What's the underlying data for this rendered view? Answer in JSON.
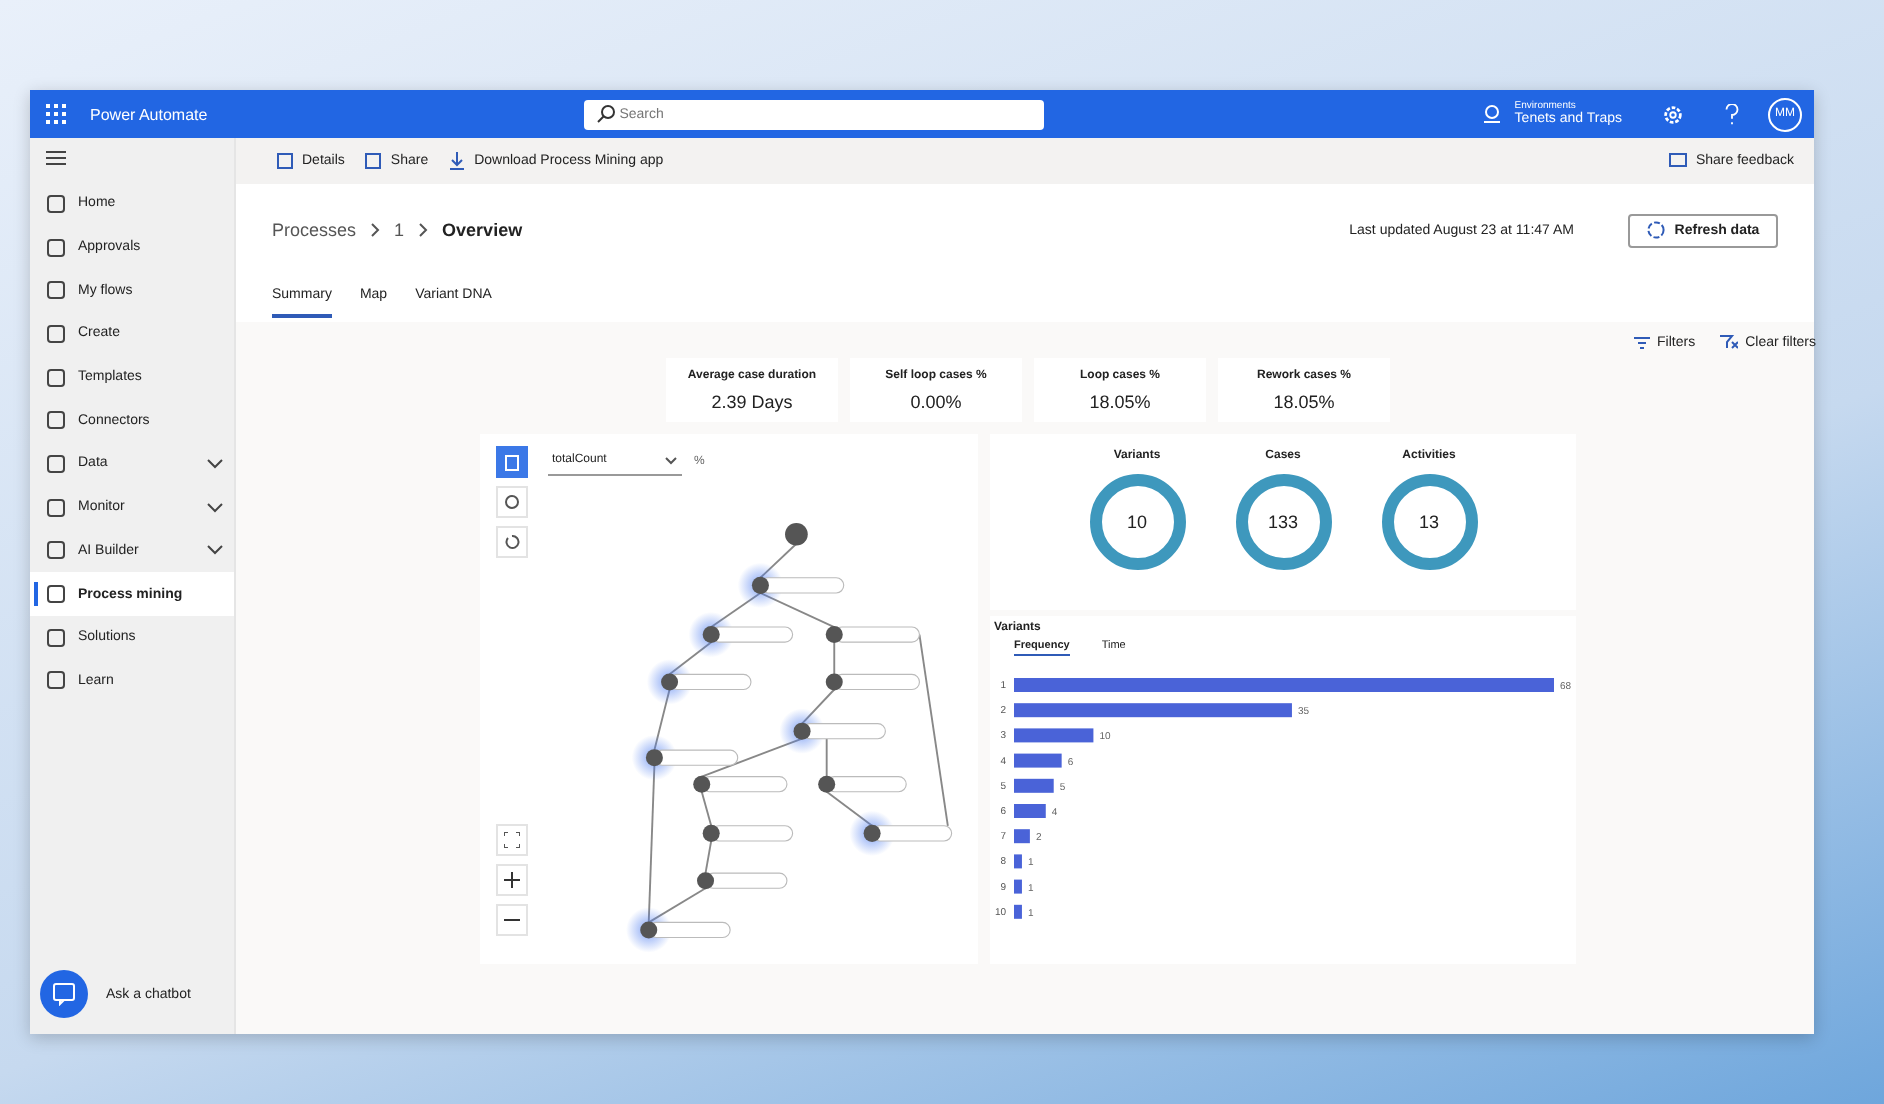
{
  "app_bar": {
    "title": "Power Automate",
    "search": {
      "placeholder": "Search"
    },
    "environment": {
      "label": "Environments",
      "name": "Tenets and Traps"
    },
    "avatar": "MM"
  },
  "sidebar": {
    "items": [
      {
        "label": "Home",
        "expandable": false,
        "selected": false
      },
      {
        "label": "Approvals",
        "expandable": false,
        "selected": false
      },
      {
        "label": "My flows",
        "expandable": false,
        "selected": false
      },
      {
        "label": "Create",
        "expandable": false,
        "selected": false
      },
      {
        "label": "Templates",
        "expandable": false,
        "selected": false
      },
      {
        "label": "Connectors",
        "expandable": false,
        "selected": false
      },
      {
        "label": "Data",
        "expandable": true,
        "selected": false
      },
      {
        "label": "Monitor",
        "expandable": true,
        "selected": false
      },
      {
        "label": "AI Builder",
        "expandable": true,
        "selected": false
      },
      {
        "label": "Process mining",
        "expandable": false,
        "selected": true
      },
      {
        "label": "Solutions",
        "expandable": false,
        "selected": false
      },
      {
        "label": "Learn",
        "expandable": false,
        "selected": false
      }
    ],
    "chatbot": "Ask a chatbot"
  },
  "command_bar": {
    "items": [
      "Details",
      "Share",
      "Download Process Mining app"
    ],
    "feedback": "Share feedback"
  },
  "breadcrumb": [
    "Processes",
    "1",
    "Overview"
  ],
  "last_updated": "Last updated August 23 at 11:47 AM",
  "refresh_button": "Refresh data",
  "tabs": [
    {
      "label": "Summary",
      "selected": true
    },
    {
      "label": "Map",
      "selected": false
    },
    {
      "label": "Variant DNA",
      "selected": false
    }
  ],
  "filters": {
    "filters": "Filters",
    "clear": "Clear filters"
  },
  "kpis": [
    {
      "label": "Average case duration",
      "value": "2.39 Days"
    },
    {
      "label": "Self loop cases %",
      "value": "0.00%"
    },
    {
      "label": "Loop cases %",
      "value": "18.05%"
    },
    {
      "label": "Rework cases %",
      "value": "18.05%"
    }
  ],
  "map": {
    "metric": "totalCount",
    "percent_toggle": "%"
  },
  "totals": [
    {
      "label": "Variants",
      "value": "10"
    },
    {
      "label": "Cases",
      "value": "133"
    },
    {
      "label": "Activities",
      "value": "13"
    }
  ],
  "variants": {
    "title": "Variants",
    "tabs": [
      {
        "label": "Frequency",
        "selected": true
      },
      {
        "label": "Time",
        "selected": false
      }
    ],
    "chart_data": {
      "type": "bar",
      "orientation": "horizontal",
      "categories": [
        "1",
        "2",
        "3",
        "4",
        "5",
        "6",
        "7",
        "8",
        "9",
        "10"
      ],
      "values": [
        68,
        35,
        10,
        6,
        5,
        4,
        2,
        1,
        1,
        1
      ],
      "data_labels": true
    }
  }
}
